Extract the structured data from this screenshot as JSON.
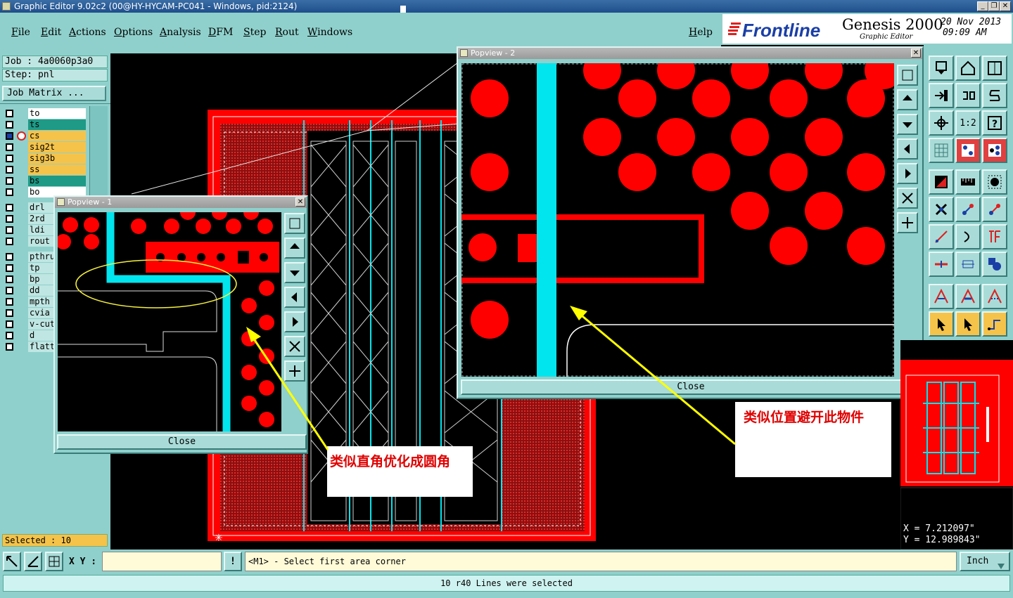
{
  "window": {
    "title": "Graphic Editor 9.02c2 (00@HY-HYCAM-PC041 - Windows, pid:2124)",
    "controls": [
      "_",
      "❐",
      "✕"
    ]
  },
  "menu": {
    "items": [
      "File",
      "Edit",
      "Actions",
      "Options",
      "Analysis",
      "DFM",
      "Step",
      "Rout",
      "Windows"
    ],
    "help": "Help"
  },
  "brand": {
    "logo": "Frontline",
    "product": "Genesis 2000",
    "subtitle": "Graphic Editor",
    "date": "20 Nov 2013",
    "time": "09:09 AM"
  },
  "job": {
    "job_line": "Job : 4a0060p3a0",
    "step_line": "Step: pnl",
    "matrix_button": "Job Matrix ..."
  },
  "layers": [
    {
      "name": "to",
      "color": "#ffffff"
    },
    {
      "name": "ts",
      "color": "#1e9a86"
    },
    {
      "name": "cs",
      "color": "#f5c34a"
    },
    {
      "name": "sig2t",
      "color": "#f5c34a"
    },
    {
      "name": "sig3b",
      "color": "#f5c34a"
    },
    {
      "name": "ss",
      "color": "#f5c34a"
    },
    {
      "name": "bs",
      "color": "#1e9a86"
    },
    {
      "name": "bo",
      "color": "#ffffff"
    },
    {
      "name": "drl",
      "color": "#bfe6e2"
    },
    {
      "name": "2rd",
      "color": "#bfe6e2"
    },
    {
      "name": "ldi",
      "color": "#bfe6e2"
    },
    {
      "name": "rout",
      "color": "#bfe6e2"
    },
    {
      "name": "pthru",
      "color": "#bfe6e2"
    },
    {
      "name": "tp",
      "color": "#bfe6e2"
    },
    {
      "name": "bp",
      "color": "#bfe6e2"
    },
    {
      "name": "dd",
      "color": "#bfe6e2"
    },
    {
      "name": "mpth",
      "color": "#bfe6e2"
    },
    {
      "name": "cvia",
      "color": "#bfe6e2"
    },
    {
      "name": "v-cut",
      "color": "#bfe6e2"
    },
    {
      "name": "d",
      "color": "#bfe6e2"
    },
    {
      "name": "flatt",
      "color": "#bfe6e2"
    }
  ],
  "selected_status": "Selected : 10",
  "popview1": {
    "title": "Popview - 1",
    "close_label": "Close"
  },
  "popview2": {
    "title": "Popview - 2",
    "close_label": "Close"
  },
  "notes": {
    "left": "类似直角优化成圆角",
    "right": "类似位置避开此物件"
  },
  "coords": {
    "x_line": "X  =  7.212097\"",
    "y_line": "Y  =  12.989843\""
  },
  "bottom": {
    "xy_label": "X Y :",
    "xy_value": "",
    "warn_label": "!",
    "prompt": "<M1> - Select first area corner",
    "unit": "Inch",
    "status": "10 r40 Lines were selected"
  },
  "colors": {
    "panel": "#8fd0cc",
    "copper": "#ff0000",
    "trace": "#00e5ee",
    "arrow": "#ffff00"
  }
}
